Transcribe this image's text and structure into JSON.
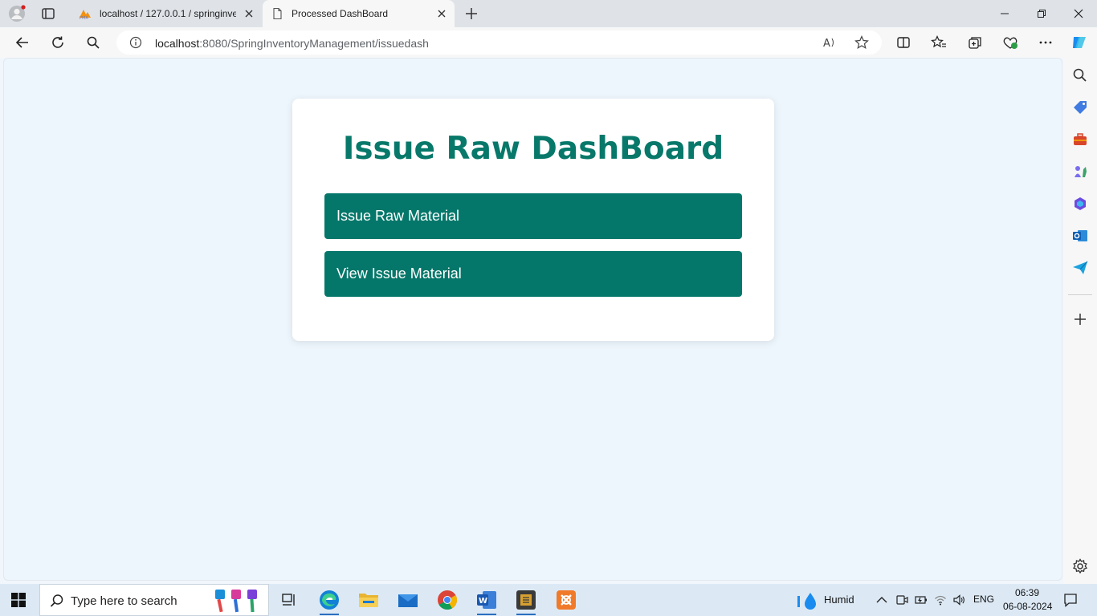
{
  "browser": {
    "tabs": [
      {
        "title": "localhost / 127.0.0.1 / springinve",
        "active": false,
        "favicon": "phpmyadmin-icon"
      },
      {
        "title": "Processed DashBoard",
        "active": true,
        "favicon": "page-icon"
      }
    ],
    "address": {
      "host": "localhost",
      "path": ":8080/SpringInventoryManagement/issuedash"
    }
  },
  "page": {
    "heading": "Issue Raw DashBoard",
    "buttons": [
      {
        "label": "Issue Raw Material"
      },
      {
        "label": "View Issue Material"
      }
    ]
  },
  "taskbar": {
    "search_placeholder": "Type here to search",
    "weather": "Humid",
    "language": "ENG",
    "time": "06:39",
    "date": "06-08-2024"
  },
  "colors": {
    "accent": "#05776a",
    "heading": "#07786a",
    "page_bg": "#eef6fd"
  }
}
